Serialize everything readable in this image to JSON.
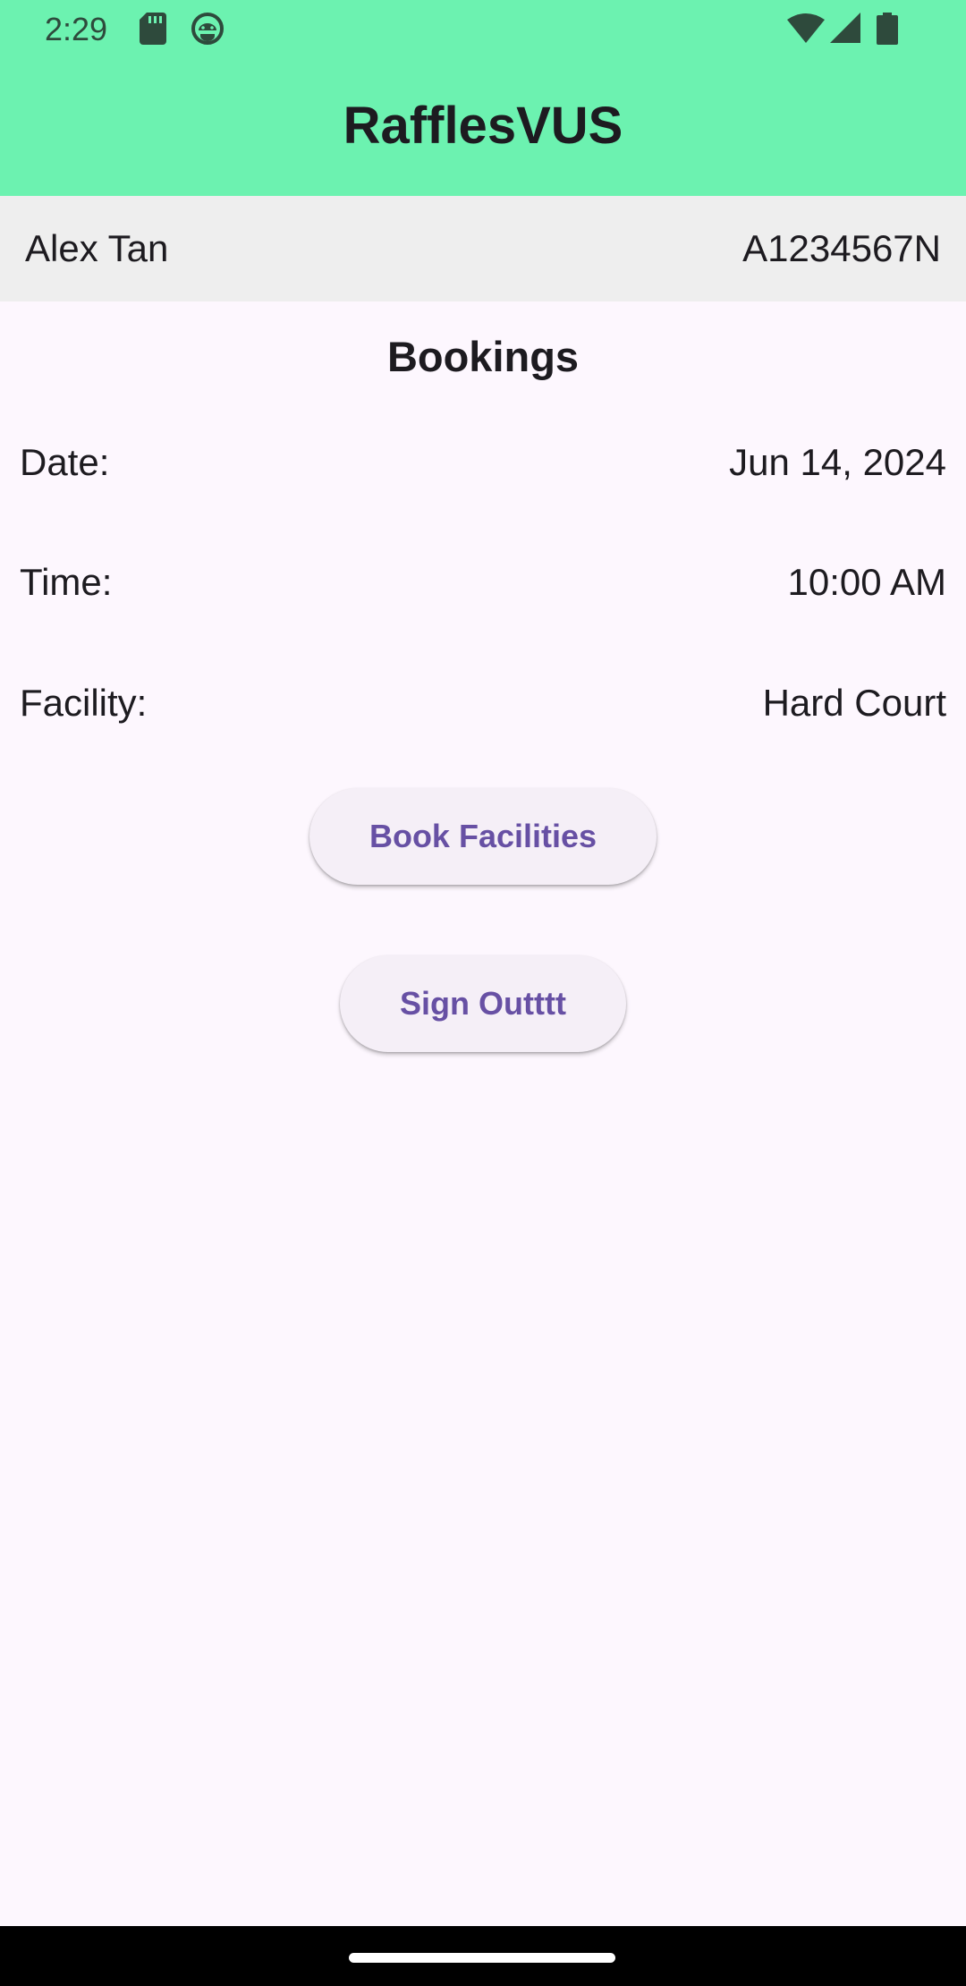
{
  "status_bar": {
    "time": "2:29",
    "left_icons": [
      "sd-card-icon",
      "android-debug-icon"
    ],
    "right_icons": [
      "wifi-icon",
      "cell-signal-icon",
      "battery-icon"
    ]
  },
  "app_bar": {
    "title": "RafflesVUS",
    "background": "#6cf2b0"
  },
  "user": {
    "name": "Alex Tan",
    "id": "A1234567N"
  },
  "bookings": {
    "title": "Bookings",
    "rows": [
      {
        "label": "Date:",
        "value": "Jun 14, 2024"
      },
      {
        "label": "Time:",
        "value": "10:00 AM"
      },
      {
        "label": "Facility:",
        "value": "Hard Court"
      }
    ]
  },
  "actions": {
    "book_label": "Book Facilities",
    "signout_label": "Sign Outttt",
    "accent": "#6750a4"
  }
}
